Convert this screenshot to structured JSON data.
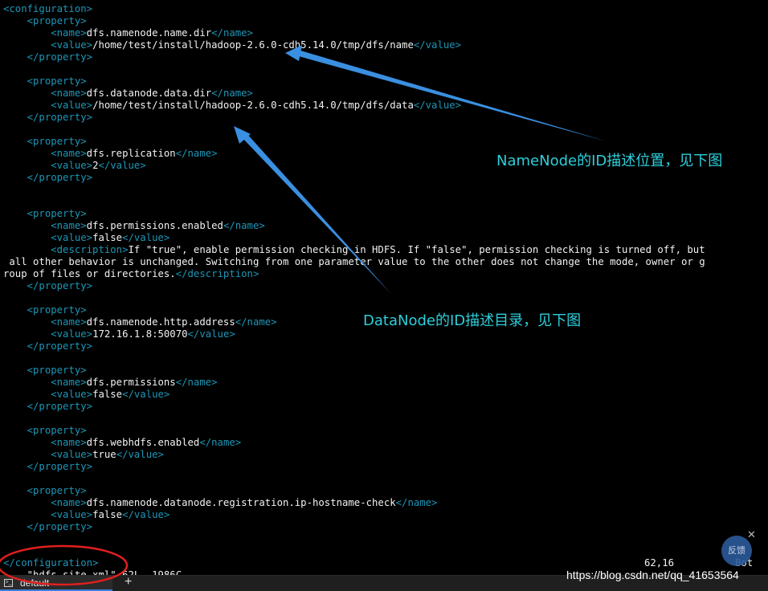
{
  "editor": {
    "lines": [
      {
        "segments": [
          {
            "text": "<configuration>",
            "kind": "tag"
          }
        ]
      },
      {
        "segments": [
          {
            "text": "    ",
            "kind": "txt"
          },
          {
            "text": "<property>",
            "kind": "tag"
          }
        ]
      },
      {
        "segments": [
          {
            "text": "        ",
            "kind": "txt"
          },
          {
            "text": "<name>",
            "kind": "tag"
          },
          {
            "text": "dfs.namenode.name.dir",
            "kind": "txt"
          },
          {
            "text": "</name>",
            "kind": "tag"
          }
        ]
      },
      {
        "segments": [
          {
            "text": "        ",
            "kind": "txt"
          },
          {
            "text": "<value>",
            "kind": "tag"
          },
          {
            "text": "/home/test/install/hadoop-2.6.0-cdh5.14.0/tmp/dfs/name",
            "kind": "txt"
          },
          {
            "text": "</value>",
            "kind": "tag"
          }
        ]
      },
      {
        "segments": [
          {
            "text": "    ",
            "kind": "txt"
          },
          {
            "text": "</property>",
            "kind": "tag"
          }
        ]
      },
      {
        "segments": [
          {
            "text": "",
            "kind": "txt"
          }
        ]
      },
      {
        "segments": [
          {
            "text": "    ",
            "kind": "txt"
          },
          {
            "text": "<property>",
            "kind": "tag"
          }
        ]
      },
      {
        "segments": [
          {
            "text": "        ",
            "kind": "txt"
          },
          {
            "text": "<name>",
            "kind": "tag"
          },
          {
            "text": "dfs.datanode.data.dir",
            "kind": "txt"
          },
          {
            "text": "</name>",
            "kind": "tag"
          }
        ]
      },
      {
        "segments": [
          {
            "text": "        ",
            "kind": "txt"
          },
          {
            "text": "<value>",
            "kind": "tag"
          },
          {
            "text": "/home/test/install/hadoop-2.6.0-cdh5.14.0/tmp/dfs/data",
            "kind": "txt"
          },
          {
            "text": "</value>",
            "kind": "tag"
          }
        ]
      },
      {
        "segments": [
          {
            "text": "    ",
            "kind": "txt"
          },
          {
            "text": "</property>",
            "kind": "tag"
          }
        ]
      },
      {
        "segments": [
          {
            "text": "",
            "kind": "txt"
          }
        ]
      },
      {
        "segments": [
          {
            "text": "    ",
            "kind": "txt"
          },
          {
            "text": "<property>",
            "kind": "tag"
          }
        ]
      },
      {
        "segments": [
          {
            "text": "        ",
            "kind": "txt"
          },
          {
            "text": "<name>",
            "kind": "tag"
          },
          {
            "text": "dfs.replication",
            "kind": "txt"
          },
          {
            "text": "</name>",
            "kind": "tag"
          }
        ]
      },
      {
        "segments": [
          {
            "text": "        ",
            "kind": "txt"
          },
          {
            "text": "<value>",
            "kind": "tag"
          },
          {
            "text": "2",
            "kind": "txt"
          },
          {
            "text": "</value>",
            "kind": "tag"
          }
        ]
      },
      {
        "segments": [
          {
            "text": "    ",
            "kind": "txt"
          },
          {
            "text": "</property>",
            "kind": "tag"
          }
        ]
      },
      {
        "segments": [
          {
            "text": "",
            "kind": "txt"
          }
        ]
      },
      {
        "segments": [
          {
            "text": "",
            "kind": "txt"
          }
        ]
      },
      {
        "segments": [
          {
            "text": "    ",
            "kind": "txt"
          },
          {
            "text": "<property>",
            "kind": "tag"
          }
        ]
      },
      {
        "segments": [
          {
            "text": "        ",
            "kind": "txt"
          },
          {
            "text": "<name>",
            "kind": "tag"
          },
          {
            "text": "dfs.permissions.enabled",
            "kind": "txt"
          },
          {
            "text": "</name>",
            "kind": "tag"
          }
        ]
      },
      {
        "segments": [
          {
            "text": "        ",
            "kind": "txt"
          },
          {
            "text": "<value>",
            "kind": "tag"
          },
          {
            "text": "false",
            "kind": "txt"
          },
          {
            "text": "</value>",
            "kind": "tag"
          }
        ]
      },
      {
        "segments": [
          {
            "text": "        ",
            "kind": "txt"
          },
          {
            "text": "<description>",
            "kind": "tag"
          },
          {
            "text": "If \"true\", enable permission checking in HDFS. If \"false\", permission checking is turned off, but",
            "kind": "txt"
          }
        ]
      },
      {
        "segments": [
          {
            "text": " all other behavior is unchanged. Switching from one parameter value to the other does not change the mode, owner or g",
            "kind": "txt"
          }
        ]
      },
      {
        "segments": [
          {
            "text": "roup of files or directories.",
            "kind": "txt"
          },
          {
            "text": "</description>",
            "kind": "tag"
          }
        ]
      },
      {
        "segments": [
          {
            "text": "    ",
            "kind": "txt"
          },
          {
            "text": "</property>",
            "kind": "tag"
          }
        ]
      },
      {
        "segments": [
          {
            "text": "",
            "kind": "txt"
          }
        ]
      },
      {
        "segments": [
          {
            "text": "    ",
            "kind": "txt"
          },
          {
            "text": "<property>",
            "kind": "tag"
          }
        ]
      },
      {
        "segments": [
          {
            "text": "        ",
            "kind": "txt"
          },
          {
            "text": "<name>",
            "kind": "tag"
          },
          {
            "text": "dfs.namenode.http.address",
            "kind": "txt"
          },
          {
            "text": "</name>",
            "kind": "tag"
          }
        ]
      },
      {
        "segments": [
          {
            "text": "        ",
            "kind": "txt"
          },
          {
            "text": "<value>",
            "kind": "tag"
          },
          {
            "text": "172.16.1.8:50070",
            "kind": "txt"
          },
          {
            "text": "</value>",
            "kind": "tag"
          }
        ]
      },
      {
        "segments": [
          {
            "text": "    ",
            "kind": "txt"
          },
          {
            "text": "</property>",
            "kind": "tag"
          }
        ]
      },
      {
        "segments": [
          {
            "text": "",
            "kind": "txt"
          }
        ]
      },
      {
        "segments": [
          {
            "text": "    ",
            "kind": "txt"
          },
          {
            "text": "<property>",
            "kind": "tag"
          }
        ]
      },
      {
        "segments": [
          {
            "text": "        ",
            "kind": "txt"
          },
          {
            "text": "<name>",
            "kind": "tag"
          },
          {
            "text": "dfs.permissions",
            "kind": "txt"
          },
          {
            "text": "</name>",
            "kind": "tag"
          }
        ]
      },
      {
        "segments": [
          {
            "text": "        ",
            "kind": "txt"
          },
          {
            "text": "<value>",
            "kind": "tag"
          },
          {
            "text": "false",
            "kind": "txt"
          },
          {
            "text": "</value>",
            "kind": "tag"
          }
        ]
      },
      {
        "segments": [
          {
            "text": "    ",
            "kind": "txt"
          },
          {
            "text": "</property>",
            "kind": "tag"
          }
        ]
      },
      {
        "segments": [
          {
            "text": "",
            "kind": "txt"
          }
        ]
      },
      {
        "segments": [
          {
            "text": "    ",
            "kind": "txt"
          },
          {
            "text": "<property>",
            "kind": "tag"
          }
        ]
      },
      {
        "segments": [
          {
            "text": "        ",
            "kind": "txt"
          },
          {
            "text": "<name>",
            "kind": "tag"
          },
          {
            "text": "dfs.webhdfs.enabled",
            "kind": "txt"
          },
          {
            "text": "</name>",
            "kind": "tag"
          }
        ]
      },
      {
        "segments": [
          {
            "text": "        ",
            "kind": "txt"
          },
          {
            "text": "<value>",
            "kind": "tag"
          },
          {
            "text": "true",
            "kind": "txt"
          },
          {
            "text": "</value>",
            "kind": "tag"
          }
        ]
      },
      {
        "segments": [
          {
            "text": "    ",
            "kind": "txt"
          },
          {
            "text": "</property>",
            "kind": "tag"
          }
        ]
      },
      {
        "segments": [
          {
            "text": "",
            "kind": "txt"
          }
        ]
      },
      {
        "segments": [
          {
            "text": "    ",
            "kind": "txt"
          },
          {
            "text": "<property>",
            "kind": "tag"
          }
        ]
      },
      {
        "segments": [
          {
            "text": "        ",
            "kind": "txt"
          },
          {
            "text": "<name>",
            "kind": "tag"
          },
          {
            "text": "dfs.namenode.datanode.registration.ip-hostname-check",
            "kind": "txt"
          },
          {
            "text": "</name>",
            "kind": "tag"
          }
        ]
      },
      {
        "segments": [
          {
            "text": "        ",
            "kind": "txt"
          },
          {
            "text": "<value>",
            "kind": "tag"
          },
          {
            "text": "false",
            "kind": "txt"
          },
          {
            "text": "</value>",
            "kind": "tag"
          }
        ]
      },
      {
        "segments": [
          {
            "text": "    ",
            "kind": "txt"
          },
          {
            "text": "</property>",
            "kind": "tag"
          }
        ]
      },
      {
        "segments": [
          {
            "text": "",
            "kind": "txt"
          }
        ]
      },
      {
        "segments": [
          {
            "text": "",
            "kind": "txt"
          }
        ]
      },
      {
        "segments": [
          {
            "text": "</configuration>",
            "kind": "tag"
          }
        ]
      }
    ],
    "status": {
      "file_info": "\"hdfs-site.xml\" 62L, 1986C",
      "cursor_position": "62,16",
      "scroll_position": "Bot"
    }
  },
  "tabbar": {
    "tab_label": "default",
    "tab_icon": "powershell-icon",
    "new_tab_label": "+"
  },
  "annotations": {
    "namenode": "NameNode的ID描述位置，见下图",
    "datanode": "DataNode的ID描述目录，见下图"
  },
  "overlay": {
    "feedback_label": "反馈",
    "feedback_close": "✕",
    "watermark": "https://blog.csdn.net/qq_41653564"
  },
  "colors": {
    "background": "#000000",
    "tag": "#1e96b6",
    "text": "#f2f2f2",
    "annotation": "#2ccfdc",
    "arrow": "#3a8fe0",
    "highlight_ellipse": "#e0201e"
  }
}
